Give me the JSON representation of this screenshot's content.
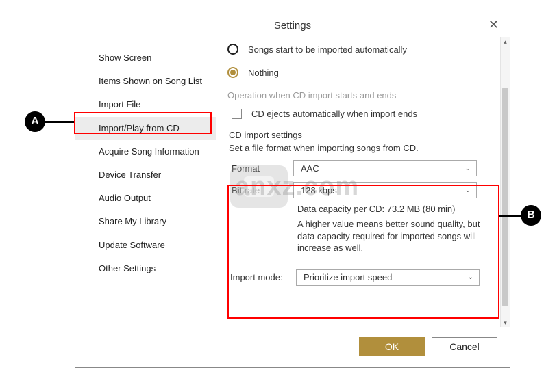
{
  "title": "Settings",
  "close_label": "✕",
  "sidebar": {
    "items": [
      {
        "label": "Show Screen"
      },
      {
        "label": "Items Shown on Song List"
      },
      {
        "label": "Import File"
      },
      {
        "label": "Import/Play from CD"
      },
      {
        "label": "Acquire Song Information"
      },
      {
        "label": "Device Transfer"
      },
      {
        "label": "Audio Output"
      },
      {
        "label": "Share My Library"
      },
      {
        "label": "Update Software"
      },
      {
        "label": "Other Settings"
      }
    ],
    "selected_index": 3
  },
  "radios": {
    "option_auto": "Songs start to be imported automatically",
    "option_nothing": "Nothing",
    "selected": "nothing"
  },
  "operation": {
    "heading": "Operation when CD import starts and ends",
    "eject_label": "CD ejects automatically when import ends",
    "eject_checked": false
  },
  "import_settings": {
    "heading": "CD import settings",
    "desc": "Set a file format when importing songs from CD.",
    "format_label": "Format",
    "format_value": "AAC",
    "bitrate_label": "Bit rate",
    "bitrate_value": "128 kbps",
    "capacity": "Data capacity per CD: 73.2 MB (80 min)",
    "note": "A higher value means better sound quality, but data capacity required for imported songs will increase as well."
  },
  "import_mode": {
    "label": "Import mode:",
    "value": "Prioritize import speed"
  },
  "footer": {
    "ok": "OK",
    "cancel": "Cancel"
  },
  "callouts": {
    "a": "A",
    "b": "B"
  },
  "watermark": "anxz.com"
}
